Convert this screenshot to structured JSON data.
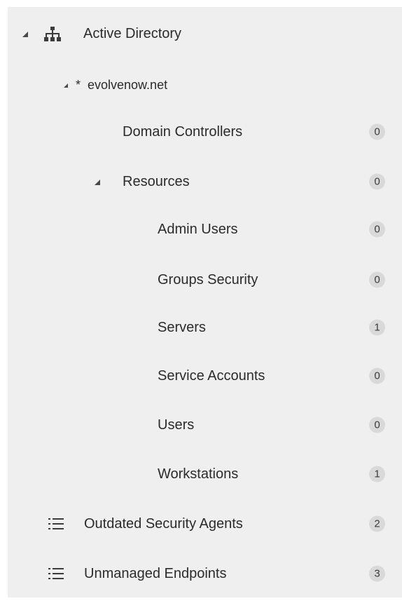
{
  "tree": {
    "root": {
      "label": "Active Directory",
      "icon": "sitemap-icon",
      "expanded": true
    },
    "domain": {
      "label": "evolvenow.net",
      "marker": "*",
      "expanded": true
    },
    "domain_controllers": {
      "label": "Domain Controllers",
      "count": "0"
    },
    "resources": {
      "label": "Resources",
      "count": "0",
      "expanded": true
    },
    "resource_children": [
      {
        "label": "Admin Users",
        "count": "0"
      },
      {
        "label": "Groups Security",
        "count": "0"
      },
      {
        "label": "Servers",
        "count": "1"
      },
      {
        "label": "Service Accounts",
        "count": "0"
      },
      {
        "label": "Users",
        "count": "0"
      },
      {
        "label": "Workstations",
        "count": "1"
      }
    ],
    "lists": [
      {
        "label": "Outdated Security Agents",
        "count": "2",
        "icon": "list-icon"
      },
      {
        "label": "Unmanaged Endpoints",
        "count": "3",
        "icon": "list-icon"
      }
    ]
  },
  "colors": {
    "panel_bg": "#efefef",
    "text": "#2b2b2b",
    "badge_bg": "#d9d9d9"
  }
}
